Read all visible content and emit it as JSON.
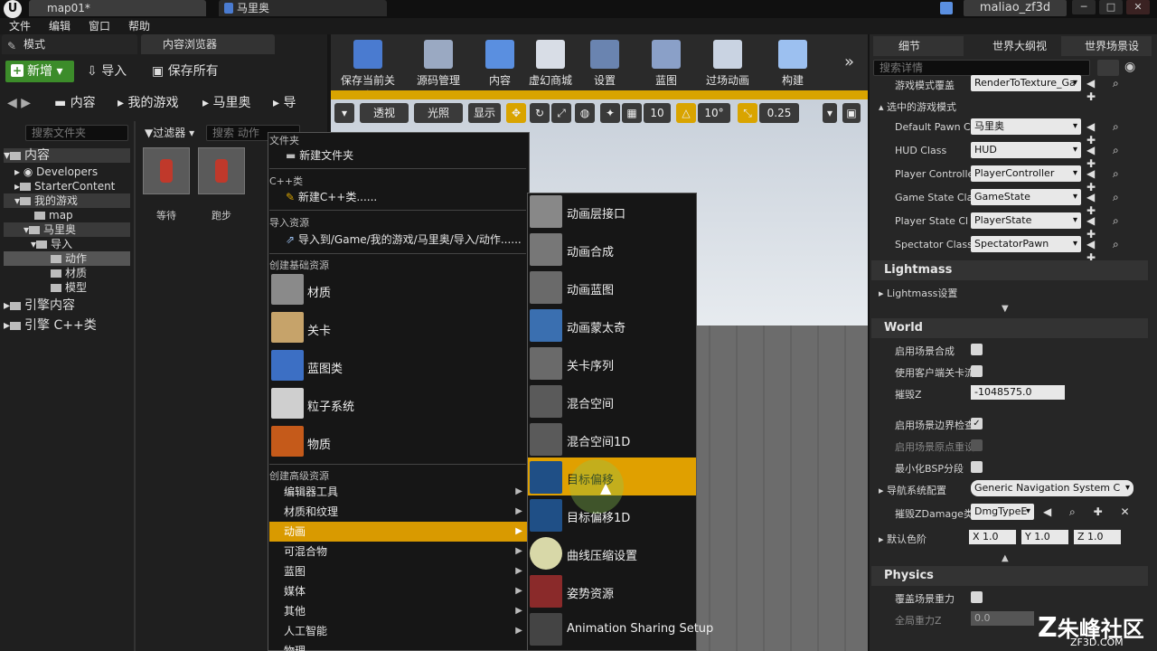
{
  "titlebar": {
    "tab1": "map01*",
    "tab2": "马里奥",
    "user": "maliao_zf3d"
  },
  "menubar": [
    "文件",
    "编辑",
    "窗口",
    "帮助"
  ],
  "left": {
    "tab_modes": "模式",
    "tab_content": "内容浏览器",
    "new_btn": "新增",
    "import_btn": "导入",
    "save_all_btn": "保存所有",
    "breadcrumb": [
      "内容",
      "我的游戏",
      "马里奥",
      "导"
    ],
    "search_folders": "搜索文件夹",
    "filter": "过滤器",
    "search_assets": "搜索 动作",
    "tree": [
      "内容",
      "Developers",
      "StarterContent",
      "我的游戏",
      "map",
      "马里奥",
      "导入",
      "动作",
      "材质",
      "模型",
      "引擎内容",
      "引擎 C++类"
    ],
    "assets": [
      "等待",
      "跑步"
    ]
  },
  "toolbar": [
    "保存当前关卡",
    "源码管理",
    "内容",
    "虚幻商城",
    "设置",
    "蓝图",
    "过场动画",
    "构建"
  ],
  "viewport": {
    "perspective": "透视",
    "lit": "光照",
    "show": "显示",
    "grid": "10",
    "angle": "10°",
    "scale": "0.25"
  },
  "menu1": {
    "sec_folder": "文件夹",
    "new_folder": "新建文件夹",
    "sec_cpp": "C++类",
    "new_cpp": "新建C++类......",
    "sec_import": "导入资源",
    "import_to": "导入到/Game/我的游戏/马里奥/导入/动作......",
    "sec_basic": "创建基础资源",
    "basic": [
      "材质",
      "关卡",
      "蓝图类",
      "粒子系统",
      "物质"
    ],
    "sec_adv": "创建高级资源",
    "adv": [
      "编辑器工具",
      "材质和纹理",
      "动画",
      "可混合物",
      "蓝图",
      "媒体",
      "其他",
      "人工智能",
      "物理"
    ]
  },
  "menu2": [
    "动画层接口",
    "动画合成",
    "动画蓝图",
    "动画蒙太奇",
    "关卡序列",
    "混合空间",
    "混合空间1D",
    "目标偏移",
    "目标偏移1D",
    "曲线压缩设置",
    "姿势资源",
    "Animation Sharing Setup"
  ],
  "right": {
    "tab_details": "细节",
    "tab_outliner": "世界大纲视",
    "tab_world": "世界场景设",
    "search": "搜索详情",
    "gm_override": "游戏模式覆盖",
    "gm_value": "RenderToTexture_Ga",
    "selected_gm": "选中的游戏模式",
    "rows": [
      {
        "label": "Default Pawn C",
        "value": "马里奥"
      },
      {
        "label": "HUD Class",
        "value": "HUD"
      },
      {
        "label": "Player Controlle",
        "value": "PlayerController"
      },
      {
        "label": "Game State Cla",
        "value": "GameState"
      },
      {
        "label": "Player State Cl",
        "value": "PlayerState"
      },
      {
        "label": "Spectator Class",
        "value": "SpectatorPawn"
      }
    ],
    "lightmass": "Lightmass",
    "lightmass_settings": "Lightmass设置",
    "world": "World",
    "world_rows": [
      "启用场景合成",
      "使用客户端关卡流",
      "摧毁Z",
      "启用场景边界检查",
      "启用场景原点重设",
      "最小化BSP分段",
      "导航系统配置",
      "摧毁ZDamage类型",
      "默认色阶"
    ],
    "kill_z": "-1048575.0",
    "nav_value": "Generic Navigation System C",
    "dmg_value": "DmgTypeE",
    "x": "X 1.0",
    "y": "Y 1.0",
    "z": "Z 1.0",
    "physics": "Physics",
    "gravity_override": "覆盖场景重力",
    "global_gravity": "全局重力Z",
    "gravity_val": "0.0"
  },
  "watermark": {
    "brand": "朱峰社区",
    "url": "ZF3D.COM"
  }
}
